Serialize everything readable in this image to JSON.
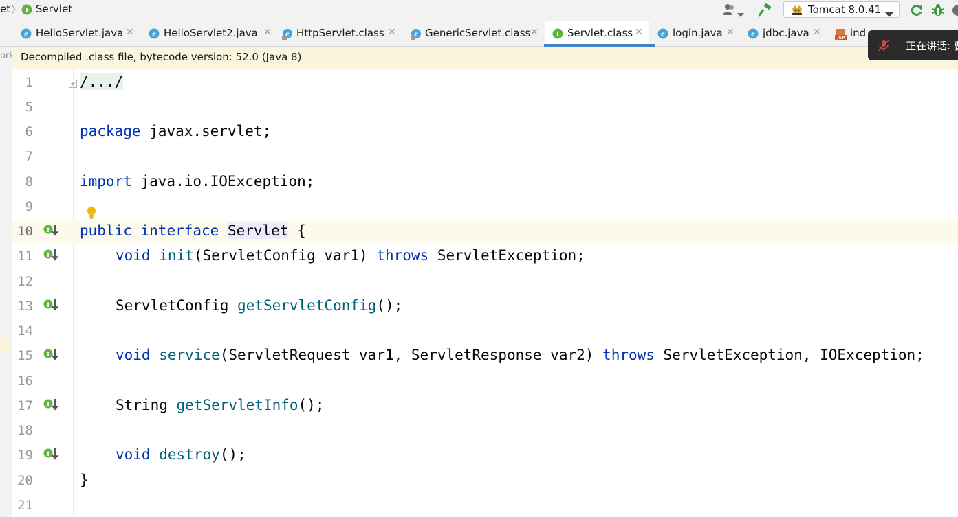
{
  "breadcrumb": {
    "project_fragment": "et",
    "current": "Servlet"
  },
  "toolbar": {
    "run_config": "Tomcat 8.0.41",
    "icons": [
      "user-icon",
      "hammer-icon",
      "tomcat-icon",
      "rerun-icon",
      "bug-icon"
    ]
  },
  "tabs": [
    {
      "label": "HelloServlet.java",
      "icon": "class-c-icon",
      "active": false
    },
    {
      "label": "HelloServlet2.java",
      "icon": "class-c-icon",
      "active": false
    },
    {
      "label": "HttpServlet.class",
      "icon": "compiled-class-icon",
      "active": false
    },
    {
      "label": "GenericServlet.class",
      "icon": "compiled-class-icon",
      "active": false
    },
    {
      "label": "Servlet.class",
      "icon": "interface-icon",
      "active": true
    },
    {
      "label": "login.java",
      "icon": "class-c-icon",
      "active": false
    },
    {
      "label": "jdbc.java",
      "icon": "class-c-icon",
      "active": false
    },
    {
      "label": "ind",
      "icon": "jsp-icon",
      "active": false
    }
  ],
  "meeting": {
    "label": "正在讲话: 曹"
  },
  "left_strip": {
    "text": "ork"
  },
  "banner": {
    "text": "Decompiled .class file, bytecode version: 52.0 (Java 8)"
  },
  "editor": {
    "line_numbers": [
      "1",
      "5",
      "6",
      "7",
      "8",
      "9",
      "10",
      "11",
      "12",
      "13",
      "14",
      "15",
      "16",
      "17",
      "18",
      "19",
      "20",
      "21"
    ],
    "current_line": "10",
    "code": {
      "l1": "/.../",
      "l6_kw": "package",
      "l6_rest": " javax.servlet;",
      "l8_kw": "import",
      "l8_rest": " java.io.IOException;",
      "l10_kw1": "public",
      "l10_sp1": " ",
      "l10_kw2": "interface",
      "l10_sp2": " ",
      "l10_name": "Servlet",
      "l10_rest": " {",
      "l11_kw": "void",
      "l11_fn": "init",
      "l11_mid": "(ServletConfig var1) ",
      "l11_kw2": "throws",
      "l11_rest": " ServletException;",
      "l13_type": "ServletConfig ",
      "l13_fn": "getServletConfig",
      "l13_rest": "();",
      "l15_kw": "void",
      "l15_fn": "service",
      "l15_mid": "(ServletRequest var1, ServletResponse var2) ",
      "l15_kw2": "throws",
      "l15_rest": " ServletException, IOException;",
      "l17_type": "String ",
      "l17_fn": "getServletInfo",
      "l17_rest": "();",
      "l19_kw": "void",
      "l19_fn": "destroy",
      "l19_rest": "();",
      "l20": "}"
    }
  }
}
